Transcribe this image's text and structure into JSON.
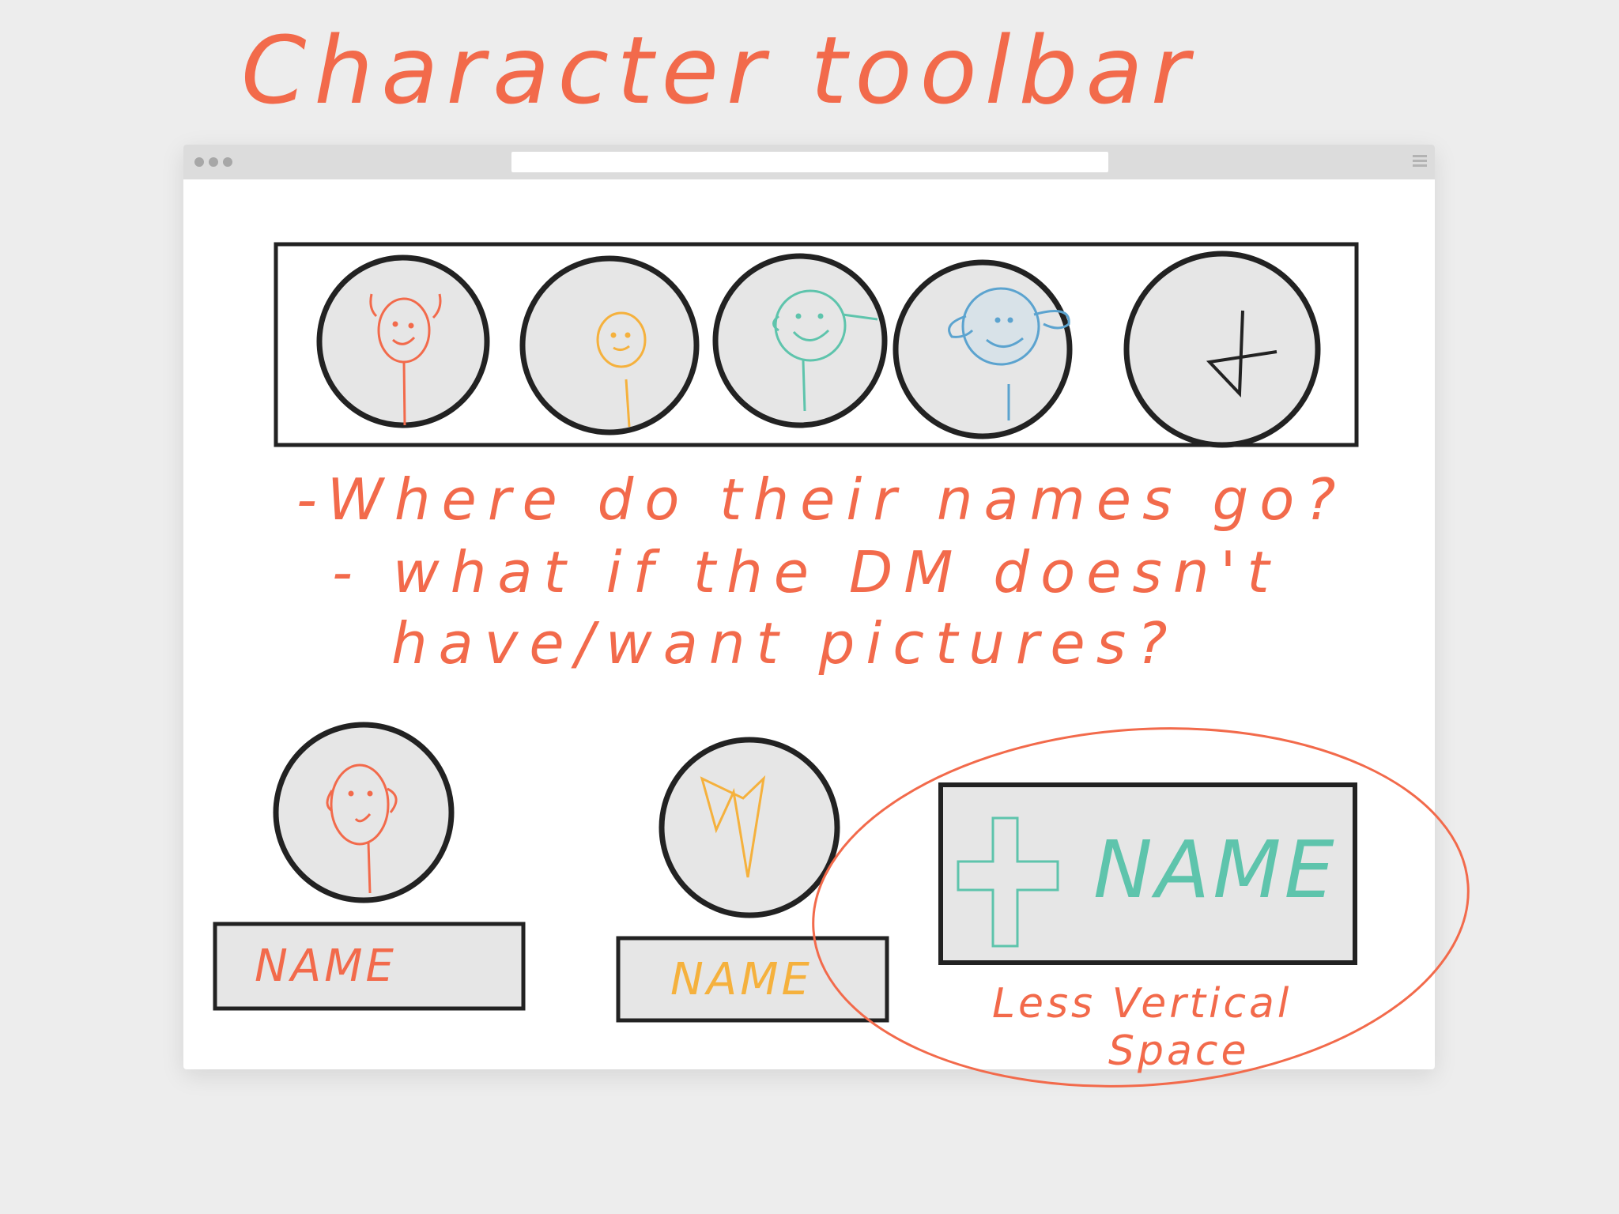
{
  "title": "Character toolbar",
  "toolbar": {
    "add_glyph": "+",
    "avatars": [
      {
        "name": "character-1",
        "color": "#f26a4b"
      },
      {
        "name": "character-2",
        "color": "#f5b13d"
      },
      {
        "name": "character-3",
        "color": "#5ec4ac"
      },
      {
        "name": "character-4",
        "color": "#5ba3cf"
      }
    ]
  },
  "notes": {
    "line1": "-Where do their names go?",
    "line2": "- what if the DM doesn't",
    "line3": "have/want pictures?"
  },
  "options": {
    "option1_label": "NAME",
    "option2_label": "NAME",
    "option3_label": "NAME",
    "option3_note_line1": "Less Vertical",
    "option3_note_line2": "Space"
  },
  "colors": {
    "ink": "#222222",
    "placeholder": "#e6e6e6",
    "red": "#f26a4b",
    "orange": "#f5b13d",
    "teal": "#5ec4ac",
    "blue": "#5ba3cf"
  }
}
